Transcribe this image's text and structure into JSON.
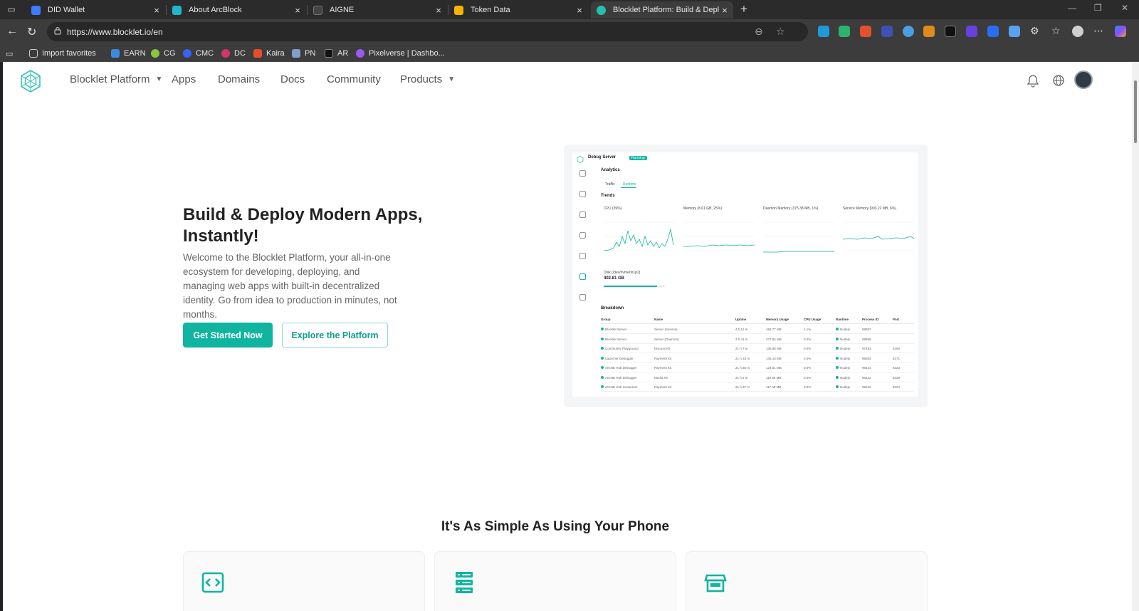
{
  "browser": {
    "tabs": [
      {
        "title": "DID Wallet",
        "color": "#3d7bff"
      },
      {
        "title": "About ArcBlock",
        "color": "#1fb7c9"
      },
      {
        "title": "AIGNE",
        "color": "#555555"
      },
      {
        "title": "Token Data",
        "color": "#f5b400"
      },
      {
        "title": "Blocklet Platform: Build & Deploy",
        "color": "#23c0b0"
      }
    ],
    "url": "https://www.blocklet.io/en",
    "bookmarks": [
      {
        "label": "Import favorites"
      },
      {
        "label": "EARN"
      },
      {
        "label": "CG"
      },
      {
        "label": "CMC"
      },
      {
        "label": "DC"
      },
      {
        "label": "Kaira"
      },
      {
        "label": "PN"
      },
      {
        "label": "AR"
      },
      {
        "label": "Pixelverse | Dashbo..."
      }
    ]
  },
  "site": {
    "nav": {
      "items": [
        {
          "label": "Blocklet Platform",
          "dropdown": true
        },
        {
          "label": "Apps"
        },
        {
          "label": "Domains"
        },
        {
          "label": "Docs"
        },
        {
          "label": "Community"
        },
        {
          "label": "Products",
          "dropdown": true
        }
      ]
    },
    "hero": {
      "title": "Build & Deploy Modern Apps, Instantly!",
      "description": "Welcome to the Blocklet Platform, your all-in-one ecosystem for developing, deploying, and managing web apps with built-in decentralized identity. Go from idea to production in minutes, not months.",
      "primary_button": "Get Started Now",
      "secondary_button": "Explore the Platform"
    },
    "preview": {
      "server_name": "Debug Server",
      "status": "Running",
      "section": "Analytics",
      "tabs": [
        "Traffic",
        "Runtime"
      ],
      "trends_label": "Trends",
      "charts": [
        "CPU (39%)",
        "Memory (8.01 GB, 25%)",
        "Daemon Memory (375.38 MB, 1%)",
        "Service Memory (993.22 MB, 6%)"
      ],
      "disk_label": "Disk (/dev/nvme0n1p2)",
      "disk_value": "402.81 GB",
      "disk_percent": 0.87,
      "breakdown_label": "Breakdown",
      "columns": [
        "Group",
        "Name",
        "Uptime",
        "Memory Usage",
        "CPU Usage",
        "Runtime",
        "Process ID",
        "Port"
      ],
      "rows": [
        [
          "Blocklet Server",
          "Server (Service)",
          "4 h 12 m",
          "493.77 MB",
          "1.1%",
          "Nodejs",
          "58997",
          ""
        ],
        [
          "Blocklet Server",
          "Server (Daemon)",
          "3 h 41 m",
          "272.84 MB",
          "0.0%",
          "Nodejs",
          "58998",
          ""
        ],
        [
          "Community Playground",
          "Discuss Kit",
          "21 h 7 m",
          "138.88 MB",
          "0.0%",
          "Nodejs",
          "97493",
          "8180"
        ],
        [
          "Launcher Debugger",
          "Payment Kit",
          "21 h 33 m",
          "135.16 MB",
          "0.0%",
          "Nodejs",
          "96563",
          "8171"
        ],
        [
          "AIGNE Hub Debugger",
          "Payment Kit",
          "21 h 35 m",
          "124.81 MB",
          "0.0%",
          "Nodejs",
          "96424",
          "8223"
        ],
        [
          "AIGNE Hub Debugger",
          "Media Kit",
          "21 h 6 m",
          "119.95 MB",
          "0.0%",
          "Nodejs",
          "96422",
          "8229"
        ],
        [
          "AIGNE Hub Consumer",
          "Payment Kit",
          "21 h 37 m",
          "117.48 MB",
          "0.0%",
          "Nodejs",
          "96242",
          "8224"
        ]
      ]
    },
    "section_title": "It's As Simple As Using Your Phone",
    "colors": {
      "accent": "#0fb5a0"
    }
  }
}
